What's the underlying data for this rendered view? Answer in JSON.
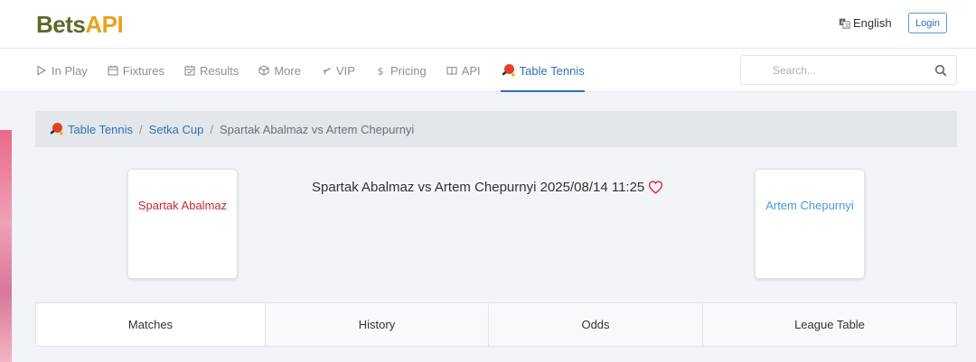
{
  "header": {
    "logo_part1": "Bets",
    "logo_part2": "API",
    "language": "English",
    "login_label": "Login"
  },
  "nav": {
    "items": [
      {
        "label": "In Play",
        "icon": "play-icon"
      },
      {
        "label": "Fixtures",
        "icon": "calendar-icon"
      },
      {
        "label": "Results",
        "icon": "calendar-check-icon"
      },
      {
        "label": "More",
        "icon": "cube-icon"
      },
      {
        "label": "VIP",
        "icon": "plane-icon"
      },
      {
        "label": "Pricing",
        "icon": "dollar-icon"
      },
      {
        "label": "API",
        "icon": "book-icon"
      },
      {
        "label": "Table Tennis",
        "icon": "table-tennis-icon",
        "active": true
      }
    ],
    "search_placeholder": "Search..."
  },
  "breadcrumb": {
    "sport": "Table Tennis",
    "league": "Setka Cup",
    "match": "Spartak Abalmaz vs Artem Chepurnyi"
  },
  "match": {
    "home_team": "Spartak Abalmaz",
    "away_team": "Artem Chepurnyi",
    "title": "Spartak Abalmaz vs Artem Chepurnyi 2025/08/14 11:25"
  },
  "tabs": [
    {
      "label": "Matches",
      "active": true
    },
    {
      "label": "History"
    },
    {
      "label": "Odds"
    },
    {
      "label": "League Table"
    }
  ],
  "colors": {
    "accent": "#2f72b8",
    "home_team": "#c8283a",
    "away_team": "#4a9ad8",
    "favorite": "#e0314b"
  }
}
